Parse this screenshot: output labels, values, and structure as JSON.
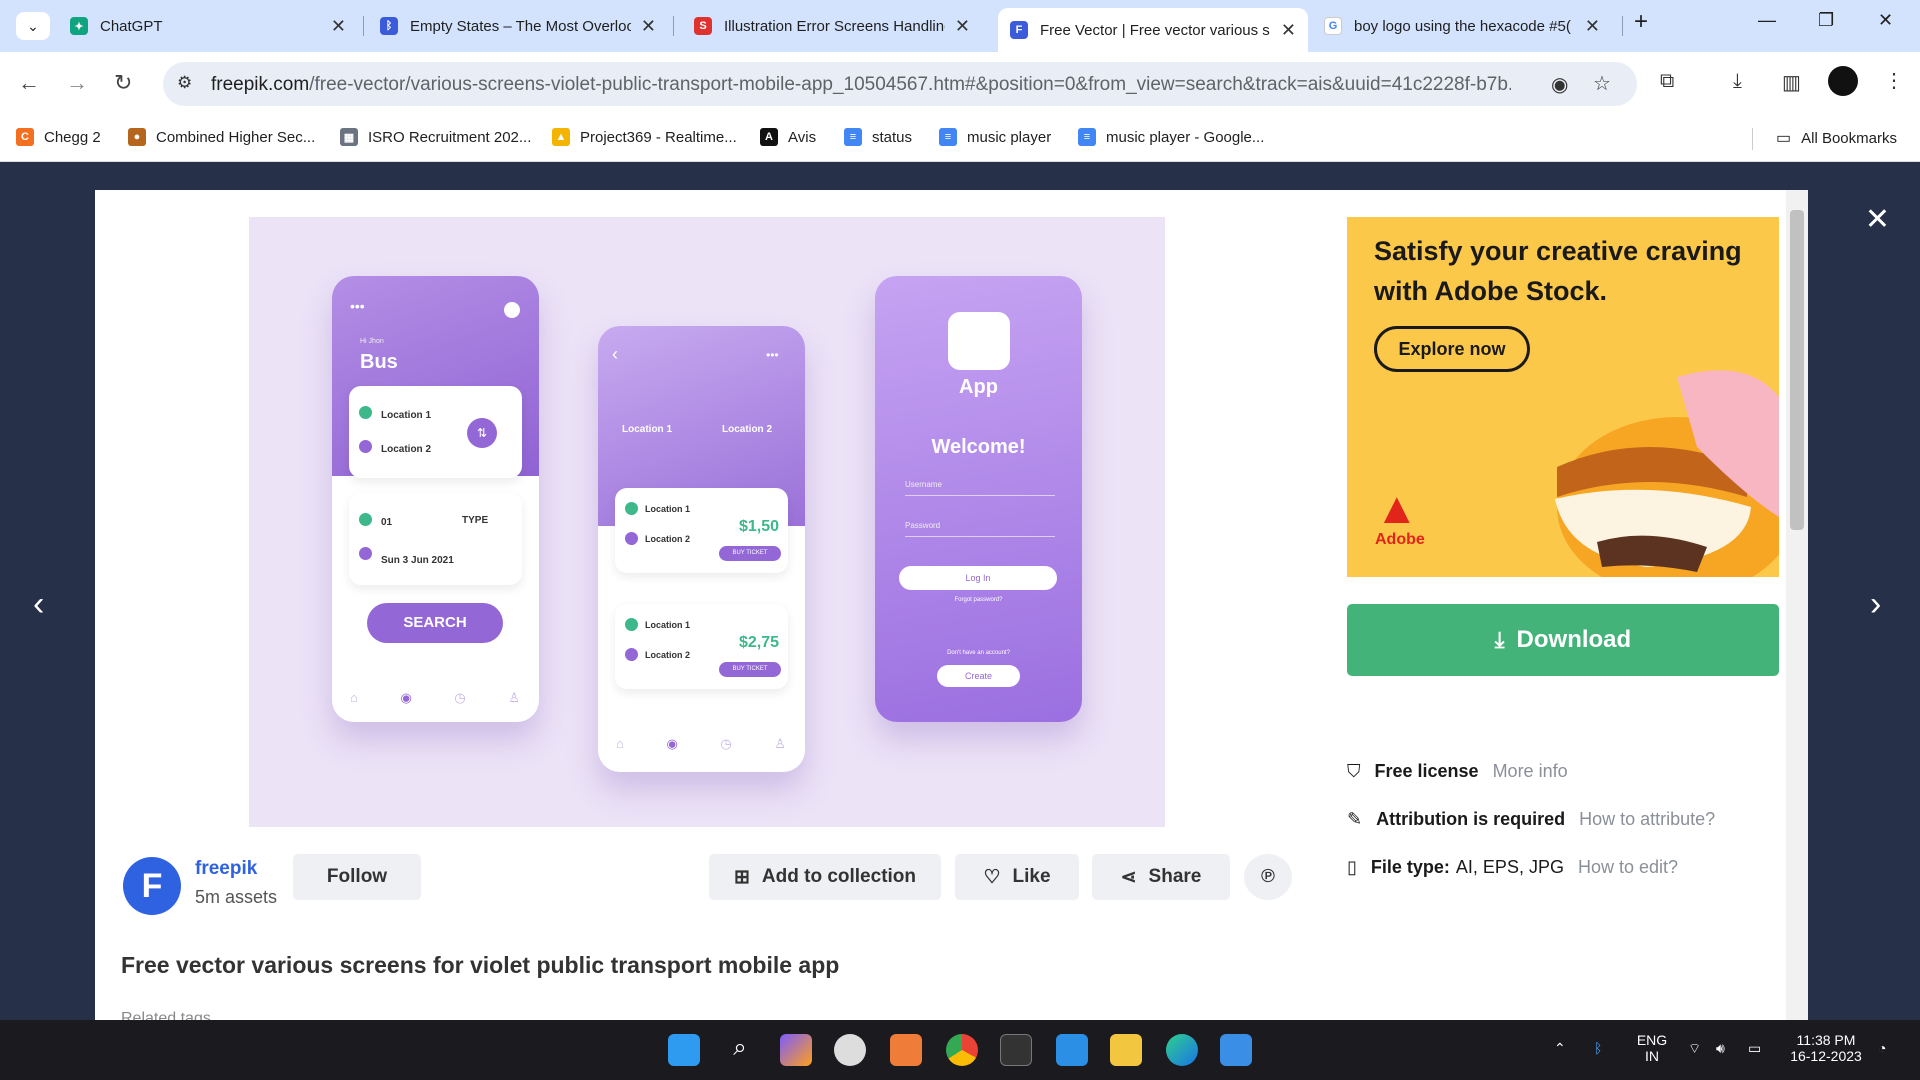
{
  "tabs": [
    {
      "title": "ChatGPT",
      "color": "#10a37f"
    },
    {
      "title": "Empty States – The Most Overloo",
      "color": "#3b5bdb"
    },
    {
      "title": "Illustration Error Screens Handling",
      "color": "#e03131"
    },
    {
      "title": "Free Vector | Free vector various s",
      "color": "#3b5bdb"
    },
    {
      "title": "boy logo using the hexacode #5(",
      "color": "#4285f4"
    }
  ],
  "address": {
    "domain": "freepik.com",
    "path": "/free-vector/various-screens-violet-public-transport-mobile-app_10504567.htm#&position=0&from_view=search&track=ais&uuid=41c2228f-b7b..."
  },
  "bookmarks": [
    {
      "label": "Chegg 2",
      "color": "#f37021"
    },
    {
      "label": "Combined Higher Sec...",
      "color": "#b5651d"
    },
    {
      "label": "ISRO Recruitment 202...",
      "color": "#6b7280"
    },
    {
      "label": "Project369 - Realtime...",
      "color": "#f4b400"
    },
    {
      "label": "Avis",
      "color": "#111111"
    },
    {
      "label": "status",
      "color": "#4285f4"
    },
    {
      "label": "music player",
      "color": "#4285f4"
    },
    {
      "label": "music player - Google...",
      "color": "#4285f4"
    }
  ],
  "all_bookmarks": "All Bookmarks",
  "preview": {
    "phone1": {
      "greet": "Hi Jhon",
      "title": "Bus",
      "from": "Location 1",
      "to": "Location 2",
      "passenger": "01",
      "type": "TYPE",
      "date": "Sun 3 Jun 2021",
      "search": "SEARCH"
    },
    "phone2": {
      "from": "Location 1",
      "to": "Location 2",
      "tickets": [
        {
          "from": "Location 1",
          "to": "Location 2",
          "price": "$1,50",
          "btn": "BUY TICKET"
        },
        {
          "from": "Location 1",
          "to": "Location 2",
          "price": "$2,75",
          "btn": "BUY TICKET"
        }
      ]
    },
    "phone3": {
      "app": "App",
      "welcome": "Welcome!",
      "username": "Username",
      "password": "Password",
      "login": "Log In",
      "forgot": "Forgot password?",
      "noacc": "Don't have an account?",
      "create": "Create"
    }
  },
  "ad": {
    "headline": "Satisfy your creative craving with Adobe Stock.",
    "button": "Explore now",
    "brand": "Adobe"
  },
  "download": "Download",
  "meta": [
    {
      "label": "Free license",
      "link": "More info"
    },
    {
      "label": "Attribution is required",
      "link": "How to attribute?"
    },
    {
      "label": "File type:",
      "value": "AI, EPS, JPG",
      "link": "How to edit?"
    }
  ],
  "author": {
    "name": "freepik",
    "assets": "5m assets",
    "initial": "F"
  },
  "actions": {
    "follow": "Follow",
    "collection": "Add to collection",
    "like": "Like",
    "share": "Share"
  },
  "caption": "Free vector various screens for violet public transport mobile app",
  "related": "Related tags",
  "tray": {
    "lang1": "ENG",
    "lang2": "IN",
    "time": "11:38 PM",
    "date": "16-12-2023"
  }
}
